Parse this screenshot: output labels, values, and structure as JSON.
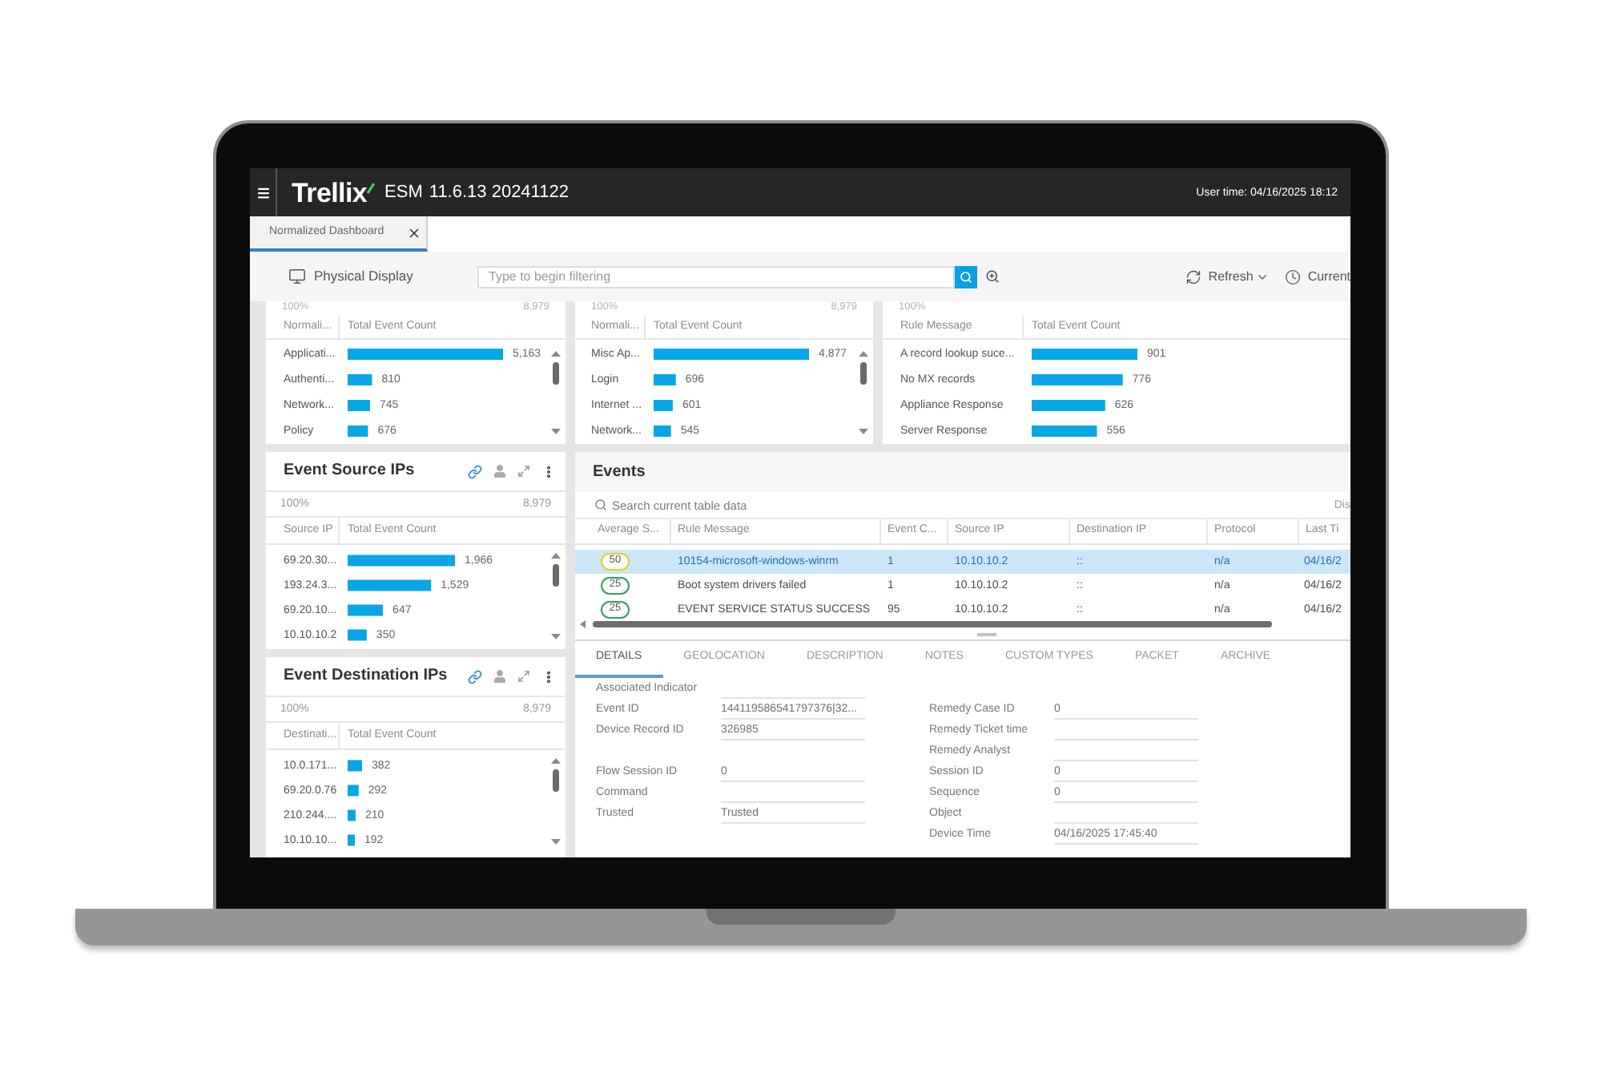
{
  "header": {
    "logo": "Trellix",
    "product": "ESM",
    "version": "11.6.13 20241122",
    "user_time": "User time: 04/16/2025 18:12"
  },
  "tabs": [
    {
      "label": "Normalized Dashboard",
      "selected": true
    }
  ],
  "toolbar": {
    "view": "Physical Display",
    "filter": {
      "placeholder": "Type to begin filtering"
    },
    "refresh": "Refresh",
    "time_range": "Current"
  },
  "top_widgets": [
    {
      "percent": "100%",
      "total": "8,979",
      "columns": [
        "Normali...",
        "Total Event Count"
      ],
      "scrollbar": true,
      "chart_data": {
        "type": "bar",
        "orientation": "horizontal",
        "categories": [
          "Applicati...",
          "Authenti...",
          "Network...",
          "Policy"
        ],
        "values": [
          5163,
          810,
          745,
          676
        ],
        "value_labels": [
          "5,163",
          "810",
          "745",
          "676"
        ]
      }
    },
    {
      "percent": "100%",
      "total": "8,979",
      "columns": [
        "Normali...",
        "Total Event Count"
      ],
      "scrollbar": true,
      "chart_data": {
        "type": "bar",
        "orientation": "horizontal",
        "categories": [
          "Misc Ap...",
          "Login",
          "Internet ...",
          "Network..."
        ],
        "values": [
          4877,
          696,
          601,
          545
        ],
        "value_labels": [
          "4,877",
          "696",
          "601",
          "545"
        ]
      }
    },
    {
      "percent": "100%",
      "columns": [
        "Rule Message",
        "Total Event Count"
      ],
      "scrollbar": false,
      "chart_data": {
        "type": "bar",
        "orientation": "horizontal",
        "categories": [
          "A record lookup suce...",
          "No MX records",
          "Appliance Response",
          "Server Response"
        ],
        "values": [
          901,
          776,
          626,
          556
        ],
        "value_labels": [
          "901",
          "776",
          "626",
          "556"
        ]
      }
    }
  ],
  "side_widgets": [
    {
      "title": "Event Source IPs",
      "percent": "100%",
      "total": "8,979",
      "columns": [
        "Source IP",
        "Total Event Count"
      ],
      "scrollbar": true,
      "chart_data": {
        "type": "bar",
        "orientation": "horizontal",
        "categories": [
          "69.20.30...",
          "193.24.3...",
          "69.20.10...",
          "10.10.10.2"
        ],
        "values": [
          1966,
          1529,
          647,
          350
        ],
        "value_labels": [
          "1,966",
          "1,529",
          "647",
          "350"
        ]
      }
    },
    {
      "title": "Event Destination IPs",
      "percent": "100%",
      "total": "8,979",
      "columns": [
        "Destinati...",
        "Total Event Count"
      ],
      "scrollbar": true,
      "chart_data": {
        "type": "bar",
        "orientation": "horizontal",
        "categories": [
          "10.0.171...",
          "69.20.0.76",
          "210.244....",
          "10.10.10..."
        ],
        "values": [
          382,
          292,
          210,
          192
        ],
        "value_labels": [
          "382",
          "292",
          "210",
          "192"
        ]
      }
    }
  ],
  "events": {
    "title": "Events",
    "search": {
      "placeholder": "Search current table data"
    },
    "display_label": "Dis",
    "columns": [
      "Average S...",
      "Rule Message",
      "Event C...",
      "Source IP",
      "Destination IP",
      "Protocol",
      "Last Ti"
    ],
    "rows": [
      {
        "severity": "50",
        "color": "#e2d21a",
        "rule_message": "10154-microsoft-windows-winrm",
        "event_count": "1",
        "source_ip": "10.10.10.2",
        "destination_ip": "::",
        "protocol": "n/a",
        "last_time": "04/16/2",
        "selected": true
      },
      {
        "severity": "25",
        "color": "#2f9f55",
        "rule_message": "Boot system drivers failed",
        "event_count": "1",
        "source_ip": "10.10.10.2",
        "destination_ip": "::",
        "protocol": "n/a",
        "last_time": "04/16/2",
        "selected": false
      },
      {
        "severity": "25",
        "color": "#2f9f55",
        "rule_message": "EVENT SERVICE STATUS SUCCESS",
        "event_count": "95",
        "source_ip": "10.10.10.2",
        "destination_ip": "::",
        "protocol": "n/a",
        "last_time": "04/16/2",
        "selected": false
      }
    ],
    "detail_tabs": [
      {
        "label": "DETAILS",
        "selected": true
      },
      {
        "label": "GEOLOCATION",
        "selected": false
      },
      {
        "label": "DESCRIPTION",
        "selected": false
      },
      {
        "label": "NOTES",
        "selected": false
      },
      {
        "label": "CUSTOM TYPES",
        "selected": false
      },
      {
        "label": "PACKET",
        "selected": false
      },
      {
        "label": "ARCHIVE",
        "selected": false
      }
    ],
    "details": [
      {
        "left": {
          "label": "Associated Indicator"
        }
      },
      {
        "left": {
          "label": "Event ID",
          "value": "144119586541797376|32..."
        },
        "right": {
          "label": "Remedy Case ID",
          "value": "0"
        }
      },
      {
        "left": {
          "label": "Device Record ID",
          "value": "326985"
        },
        "right": {
          "label": "Remedy Ticket time"
        }
      },
      {
        "right": {
          "label": "Remedy Analyst"
        }
      },
      {
        "left": {
          "label": "Flow Session ID",
          "value": "0"
        },
        "right": {
          "label": "Session ID",
          "value": "0"
        }
      },
      {
        "left": {
          "label": "Command"
        },
        "right": {
          "label": "Sequence",
          "value": "0"
        }
      },
      {
        "left": {
          "label": "Trusted",
          "value": "Trusted"
        },
        "right": {
          "label": "Object"
        }
      },
      {
        "right": {
          "label": "Device Time",
          "value": "04/16/2025 17:45:40"
        }
      }
    ]
  }
}
